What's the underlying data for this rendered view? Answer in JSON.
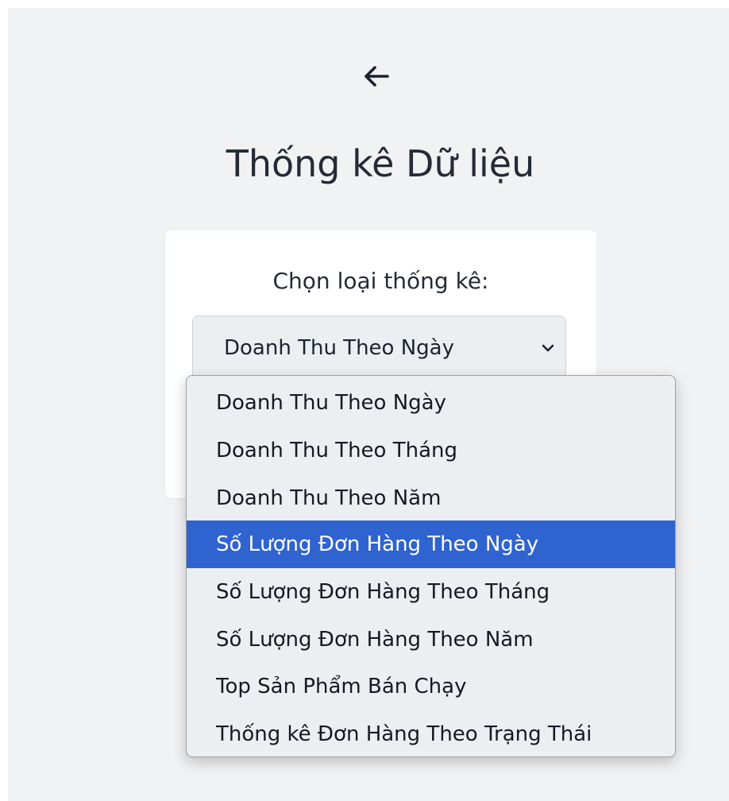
{
  "header": {
    "back_icon": "arrow-left-icon",
    "title": "Thống kê Dữ liệu"
  },
  "card": {
    "label": "Chọn loại thống kê:",
    "select": {
      "value": "Doanh Thu Theo Ngày",
      "chevron_icon": "chevron-down-icon"
    }
  },
  "dropdown": {
    "highlighted_index": 3,
    "options": [
      {
        "label": "Doanh Thu Theo Ngày"
      },
      {
        "label": "Doanh Thu Theo Tháng"
      },
      {
        "label": "Doanh Thu Theo Năm"
      },
      {
        "label": "Số Lượng Đơn Hàng Theo Ngày"
      },
      {
        "label": "Số Lượng Đơn Hàng Theo Tháng"
      },
      {
        "label": "Số Lượng Đơn Hàng Theo Năm"
      },
      {
        "label": "Top Sản Phẩm Bán Chạy"
      },
      {
        "label": "Thống kê Đơn Hàng Theo Trạng Thái"
      }
    ]
  },
  "colors": {
    "page_background": "#f1f2f4",
    "text": "#242b36",
    "highlight": "#2f63d0",
    "select_background": "#eceff1"
  }
}
